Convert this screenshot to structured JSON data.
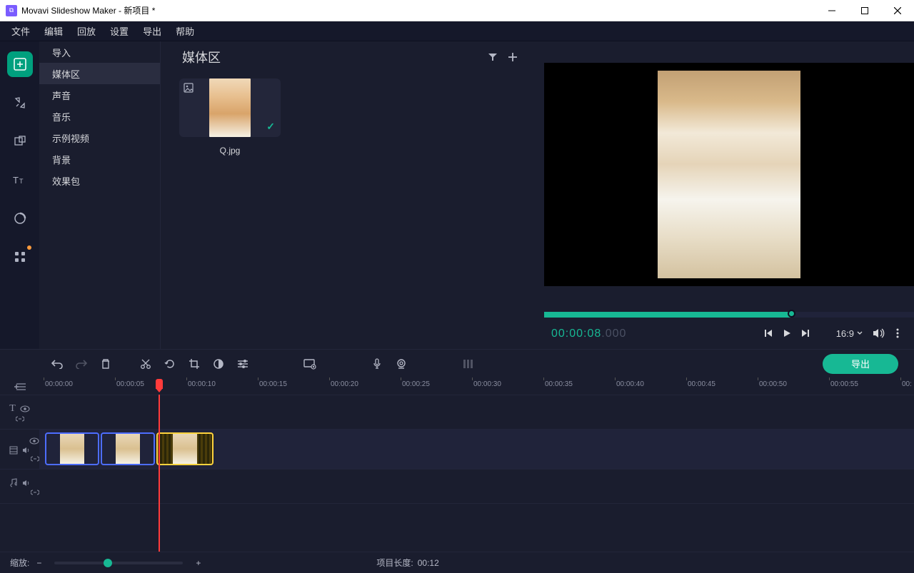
{
  "title": "Movavi Slideshow Maker - 新项目 *",
  "menu": {
    "file": "文件",
    "edit": "编辑",
    "playback": "回放",
    "settings": "设置",
    "export": "导出",
    "help": "帮助"
  },
  "subnav": {
    "import": "导入",
    "media": "媒体区",
    "sound": "声音",
    "music": "音乐",
    "sample": "示例视频",
    "background": "背景",
    "effects": "效果包"
  },
  "media": {
    "title": "媒体区",
    "item1": "Q.jpg"
  },
  "preview": {
    "time": "00:00:08",
    "ms": ".000",
    "aspect": "16:9"
  },
  "ruler": {
    "t0": "00:00:00",
    "t1": "00:00:05",
    "t2": "00:00:10",
    "t3": "00:00:15",
    "t4": "00:00:20",
    "t5": "00:00:25",
    "t6": "00:00:30",
    "t7": "00:00:35",
    "t8": "00:00:40",
    "t9": "00:00:45",
    "t10": "00:00:50",
    "t11": "00:00:55",
    "t12": "00:"
  },
  "export_btn": "导出",
  "status": {
    "zoom_label": "缩放:",
    "len_label": "项目长度:",
    "len_val": "00:12"
  }
}
